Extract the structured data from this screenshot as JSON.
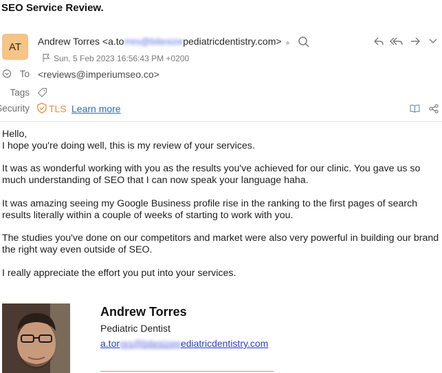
{
  "subject": "SEO Service Review.",
  "sender": {
    "initials": "AT",
    "name": "Andrew Torres",
    "email_visible_start": "<a.to",
    "email_blurred": "rres@bitesize",
    "email_visible_end": "pediatricdentistry.com>",
    "date": "Sun, 5 Feb 2023 16:56:43 PM +0200"
  },
  "header_rows": {
    "to_label": "To",
    "to_value": "<reviews@imperiumseo.co>",
    "tags_label": "Tags",
    "security_label": "Security",
    "tls_label": "TLS",
    "learn_more": "Learn more"
  },
  "icons": {
    "search": "search-icon",
    "reply": "reply-icon",
    "reply_all": "reply-all-icon",
    "forward": "forward-icon",
    "more": "chevron-down-icon",
    "flag": "flag-icon",
    "tag": "tag-icon",
    "shield": "shield-icon",
    "book": "book-icon",
    "share": "share-icon"
  },
  "body": {
    "greeting": "Hello,",
    "p1": "I hope you're doing well, this is my review of your services.",
    "p2": "It was as wonderful working with you as the results you've achieved for our clinic. You gave us so much understanding of SEO that I can now speak your language haha.",
    "p3": "It was amazing seeing my Google Business profile rise in the ranking to the first pages of search results literally within a couple of weeks of starting to work with you.",
    "p4": "The studies you've done on our competitors and market were also very powerful in building our brand the right way even outside of SEO.",
    "p5": "I really appreciate the effort you put into your services."
  },
  "signature": {
    "name": "Andrew Torres",
    "title": "Pediatric Dentist",
    "email_start": "a.tor",
    "email_blurred": "res@bitesizep",
    "email_end": "ediatricdentistry.com"
  },
  "colors": {
    "avatar_bg": "#f5c486",
    "tls": "#e0913a",
    "link": "#2a6db8",
    "signature_link": "#2b3ec9"
  }
}
